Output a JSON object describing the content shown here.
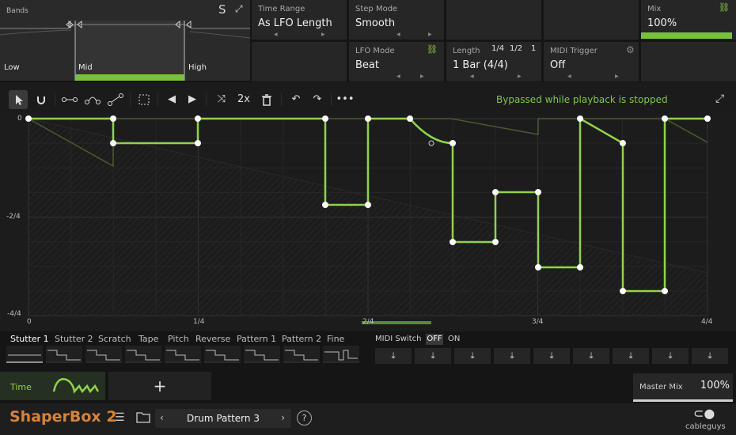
{
  "bands": {
    "label": "Bands",
    "solo": "S",
    "items": [
      "Low",
      "Mid",
      "High"
    ],
    "selected_band": "Mid"
  },
  "settings": {
    "time_range": {
      "label": "Time Range",
      "value": "As LFO Length"
    },
    "step_mode": {
      "label": "Step Mode",
      "value": "Smooth"
    },
    "lfo_mode": {
      "label": "LFO Mode",
      "value": "Beat"
    },
    "length": {
      "label": "Length",
      "value": "1 Bar (4/4)",
      "options": [
        "1/4",
        "1/2",
        "1"
      ]
    },
    "midi_trigger": {
      "label": "MIDI Trigger",
      "value": "Off"
    },
    "mix": {
      "label": "Mix",
      "value": "100%",
      "level": 1.0
    }
  },
  "toolbar": {
    "speed": "2x",
    "status": "Bypassed while playback is stopped"
  },
  "editor": {
    "y_labels": [
      "0",
      "-2/4",
      "-4/4"
    ],
    "x_labels": [
      "0",
      "1/4",
      "2/4",
      "3/4",
      "4/4"
    ],
    "accent": "#8fd44a"
  },
  "presets": {
    "tabs": [
      "Stutter 1",
      "Stutter 2",
      "Scratch",
      "Tape",
      "Pitch",
      "Reverse",
      "Pattern 1",
      "Pattern 2",
      "Fine"
    ],
    "active": "Stutter 1",
    "midi_switch": {
      "label": "MIDI Switch",
      "off": "OFF",
      "on": "ON",
      "state": "OFF"
    },
    "download_icon": "download-icon"
  },
  "modules": {
    "time": {
      "label": "Time"
    },
    "add": "+"
  },
  "master": {
    "label": "Master Mix",
    "value": "100%",
    "level": 1.0
  },
  "footer": {
    "product": "ShaperBox",
    "version": "2",
    "pattern": "Drum Pattern 3",
    "help": "?",
    "brand": "cableguys"
  }
}
